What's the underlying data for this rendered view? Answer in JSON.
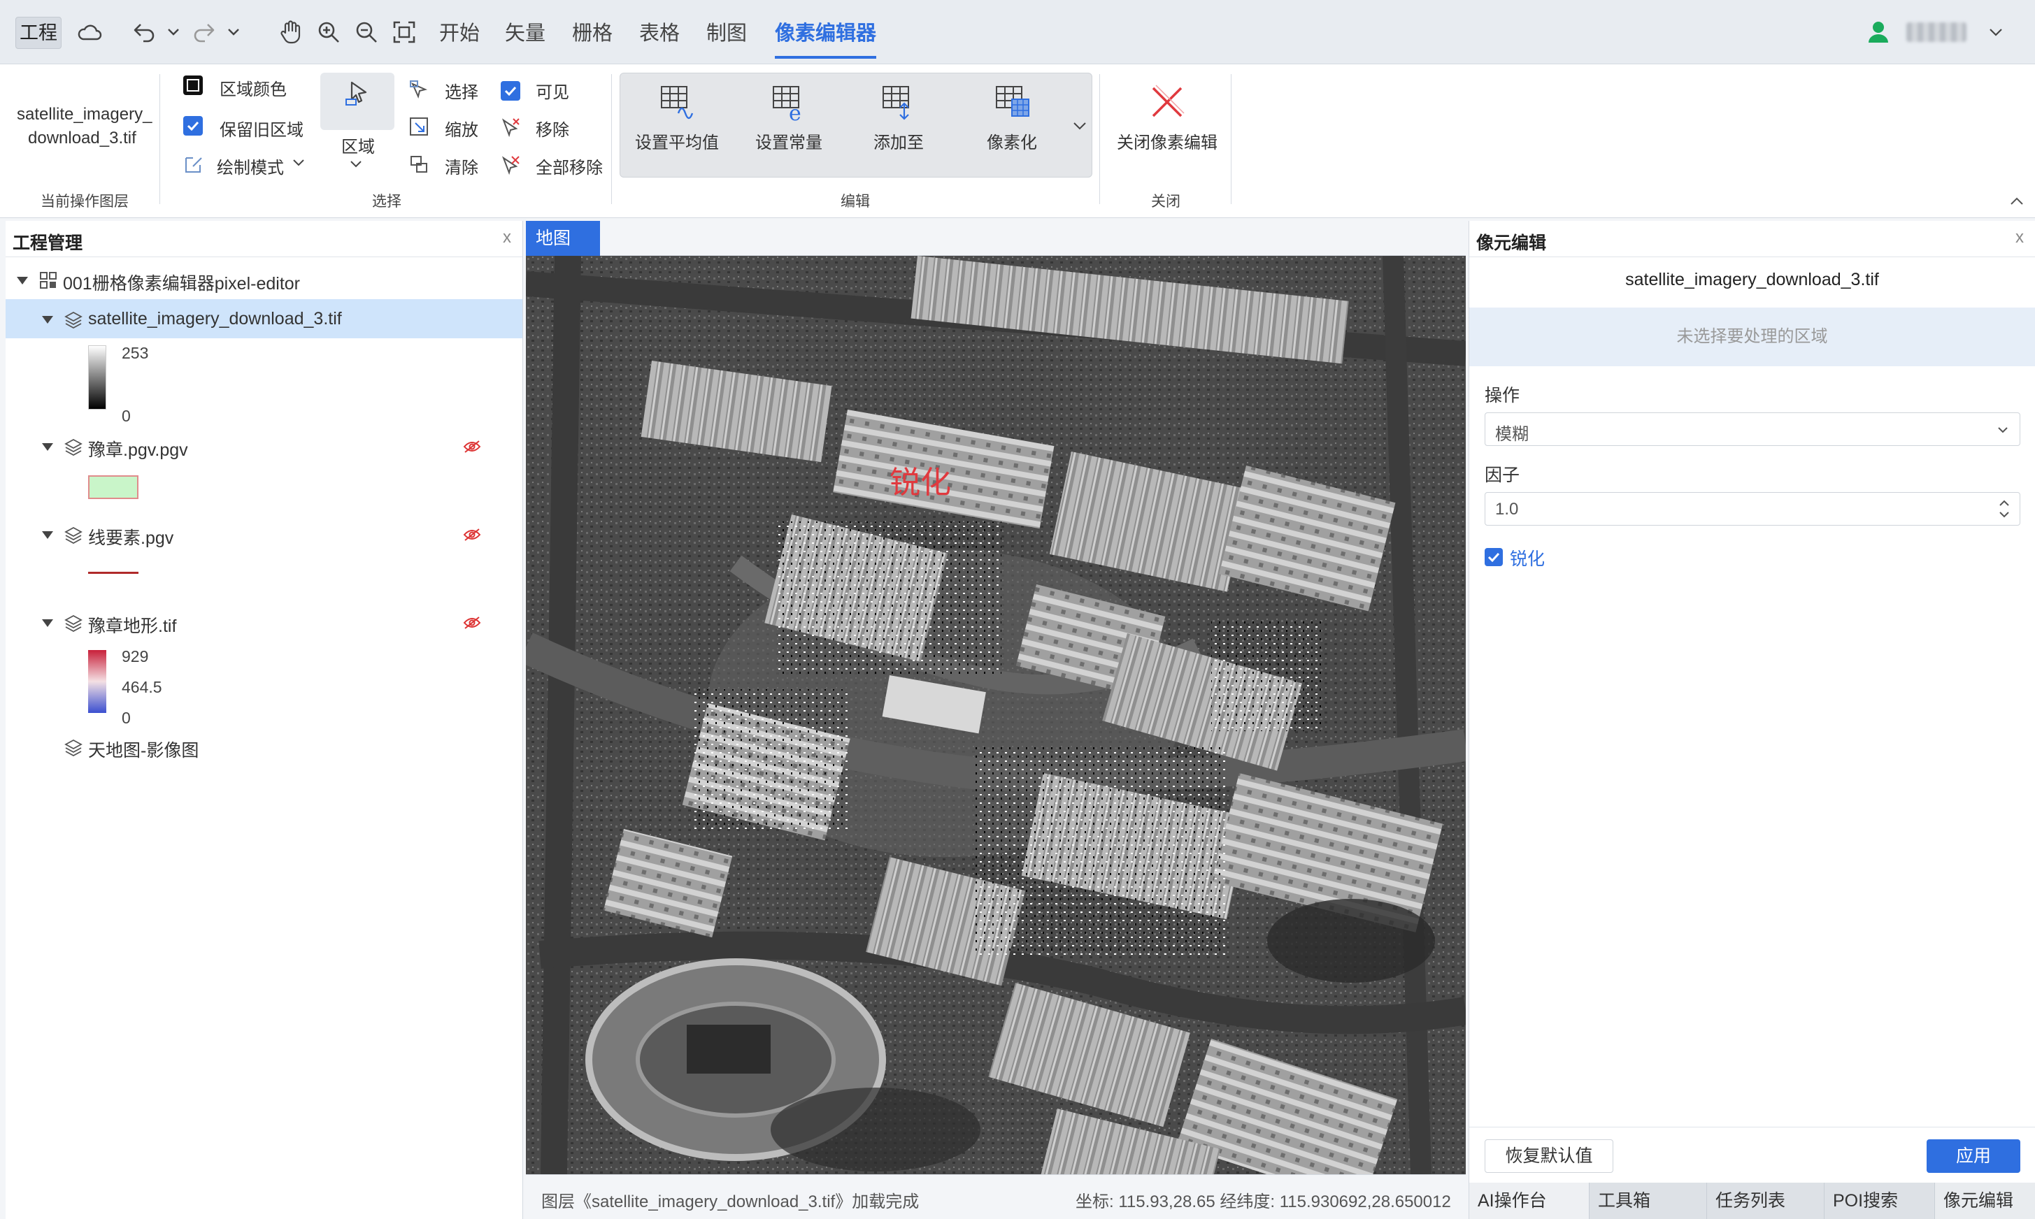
{
  "menubar": {
    "project": "工程",
    "tabs": [
      "开始",
      "矢量",
      "栅格",
      "表格",
      "制图",
      "像素编辑器"
    ],
    "active_tab": "像素编辑器"
  },
  "ribbon": {
    "current_layer": {
      "name_line1": "satellite_imagery_",
      "name_line2": "download_3.tif",
      "group_label": "当前操作图层"
    },
    "select_group": {
      "region_color": "区域颜色",
      "keep_old_region": "保留旧区域",
      "draw_mode": "绘制模式",
      "region": "区域",
      "select": "选择",
      "zoom": "缩放",
      "clear": "清除",
      "visible": "可见",
      "remove": "移除",
      "remove_all": "全部移除",
      "group_label": "选择"
    },
    "edit_group": {
      "set_mean": "设置平均值",
      "set_const": "设置常量",
      "add_to": "添加至",
      "pixelate": "像素化",
      "group_label": "编辑"
    },
    "close_group": {
      "close_edit": "关闭像素编辑",
      "group_label": "关闭"
    }
  },
  "left_panel": {
    "title": "工程管理",
    "close": "x",
    "project_name": "001栅格像素编辑器pixel-editor",
    "layers": [
      {
        "name": "satellite_imagery_download_3.tif",
        "legend_max": "253",
        "legend_min": "0"
      },
      {
        "name": "豫章.pgv.pgv"
      },
      {
        "name": "线要素.pgv"
      },
      {
        "name": "豫章地形.tif",
        "legend_max": "929",
        "legend_mid": "464.5",
        "legend_min": "0"
      },
      {
        "name": "天地图-影像图"
      }
    ]
  },
  "map": {
    "tab": "地图",
    "overlay_label": "锐化",
    "status_left": "图层《satellite_imagery_download_3.tif》加载完成",
    "status_right": "坐标: 115.93,28.65 经纬度: 115.930692,28.650012"
  },
  "right_panel": {
    "title": "像元编辑",
    "close": "x",
    "file": "satellite_imagery_download_3.tif",
    "hint": "未选择要处理的区域",
    "operation_label": "操作",
    "operation_value": "模糊",
    "factor_label": "因子",
    "factor_value": "1.0",
    "sharpen_label": "锐化",
    "sharpen_checked": true,
    "reset_button": "恢复默认值",
    "apply_button": "应用",
    "bottom_tabs": [
      "AI操作台",
      "工具箱",
      "任务列表",
      "POI搜索",
      "像元编辑"
    ]
  },
  "colors": {
    "accent": "#2f6fe0",
    "selected_row": "#cfe4fb",
    "close_red": "#e0393e",
    "user_green": "#1aab5c"
  }
}
